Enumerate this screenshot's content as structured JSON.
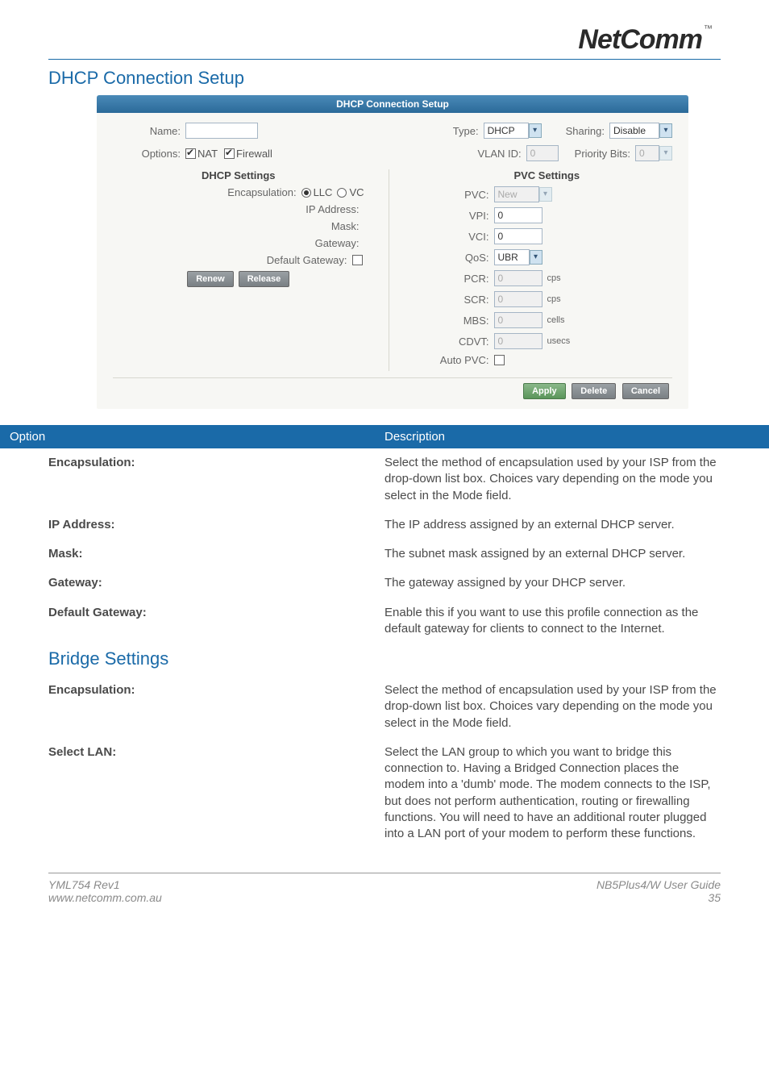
{
  "logo": {
    "brand": "NetComm",
    "tm": "™"
  },
  "section_title": "DHCP Connection Setup",
  "panel": {
    "title": "DHCP Connection Setup",
    "name_label": "Name:",
    "name_value": "",
    "type_label": "Type:",
    "type_value": "DHCP",
    "sharing_label": "Sharing:",
    "sharing_value": "Disable",
    "options_label": "Options:",
    "opt_nat": "NAT",
    "opt_fw": "Firewall",
    "vlan_label": "VLAN ID:",
    "vlan_value": "0",
    "prio_label": "Priority Bits:",
    "prio_value": "0",
    "dhcp": {
      "head": "DHCP Settings",
      "encap_label": "Encapsulation:",
      "encap_llc": "LLC",
      "encap_vc": "VC",
      "ip_label": "IP Address:",
      "mask_label": "Mask:",
      "gw_label": "Gateway:",
      "defgw_label": "Default Gateway:",
      "renew": "Renew",
      "release": "Release"
    },
    "pvc": {
      "head": "PVC Settings",
      "pvc_label": "PVC:",
      "pvc_value": "New",
      "vpi_label": "VPI:",
      "vpi_value": "0",
      "vci_label": "VCI:",
      "vci_value": "0",
      "qos_label": "QoS:",
      "qos_value": "UBR",
      "pcr_label": "PCR:",
      "pcr_value": "0",
      "pcr_unit": "cps",
      "scr_label": "SCR:",
      "scr_value": "0",
      "scr_unit": "cps",
      "mbs_label": "MBS:",
      "mbs_value": "0",
      "mbs_unit": "cells",
      "cdvt_label": "CDVT:",
      "cdvt_value": "0",
      "cdvt_unit": "usecs",
      "auto_label": "Auto PVC:"
    },
    "buttons": {
      "apply": "Apply",
      "delete": "Delete",
      "cancel": "Cancel"
    }
  },
  "table": {
    "head_option": "Option",
    "head_desc": "Description",
    "rows": [
      {
        "opt": "Encapsulation:",
        "desc": "Select the method of encapsulation used by your ISP from the drop-down list box. Choices vary depending on the mode you select in the Mode field."
      },
      {
        "opt": "IP Address:",
        "desc": "The IP address assigned by an external DHCP server."
      },
      {
        "opt": "Mask:",
        "desc": "The subnet mask assigned by an external DHCP server."
      },
      {
        "opt": "Gateway:",
        "desc": "The gateway assigned by your DHCP server."
      },
      {
        "opt": "Default Gateway:",
        "desc": "Enable this if you want to use this profile connection as the default gateway for clients to connect to the Internet."
      }
    ]
  },
  "bridge": {
    "title": "Bridge Settings",
    "rows": [
      {
        "opt": "Encapsulation:",
        "desc": "Select the method of encapsulation used by your ISP from the drop-down list box. Choices vary depending on the mode you select in the Mode field."
      },
      {
        "opt": "Select LAN:",
        "desc": "Select the LAN group to which you want to bridge this connection to. Having a Bridged Connection places the modem into a 'dumb' mode. The modem connects to the ISP, but does not perform authentication, routing or firewalling functions. You will need to have an additional router plugged into a LAN port of your modem to perform these functions."
      }
    ]
  },
  "footer": {
    "left1": "YML754 Rev1",
    "left2": "www.netcomm.com.au",
    "right1": "NB5Plus4/W User Guide",
    "right2": "35"
  }
}
